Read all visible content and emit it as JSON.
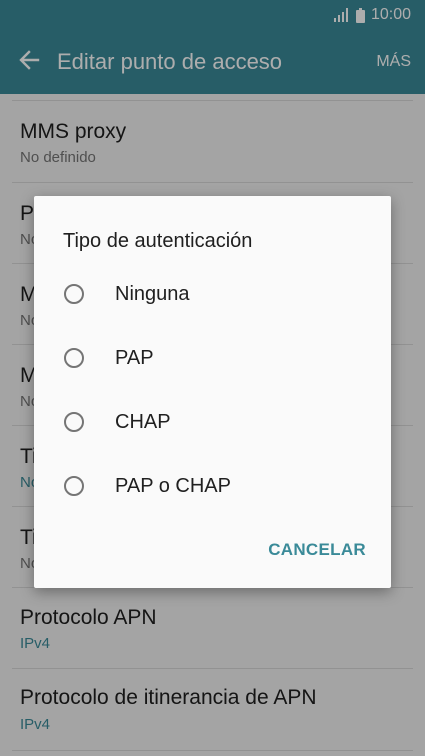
{
  "status_bar": {
    "time": "10:00",
    "icons": [
      "signal-icon",
      "battery-icon"
    ]
  },
  "app_bar": {
    "back_icon": "back-arrow-icon",
    "title": "Editar punto de acceso",
    "more_label": "MÁS"
  },
  "settings_list": {
    "items": [
      {
        "title": "MMS proxy",
        "subtitle": "No definido"
      },
      {
        "title": "P",
        "subtitle": "No"
      },
      {
        "title": "M",
        "subtitle": "No"
      },
      {
        "title": "M",
        "subtitle": "No"
      },
      {
        "title": "Ti",
        "subtitle": "No"
      },
      {
        "title": "Ti",
        "subtitle": "No"
      },
      {
        "title": "Protocolo APN",
        "subtitle": "IPv4"
      },
      {
        "title": "Protocolo de itinerancia de APN",
        "subtitle": "IPv4"
      }
    ]
  },
  "dialog": {
    "title": "Tipo de autenticación",
    "options": [
      {
        "label": "Ninguna",
        "selected": false
      },
      {
        "label": "PAP",
        "selected": false
      },
      {
        "label": "CHAP",
        "selected": false
      },
      {
        "label": "PAP o CHAP",
        "selected": false
      }
    ],
    "cancel_label": "CANCELAR"
  },
  "colors": {
    "primary": "#3a8a98",
    "text_primary": "#202020",
    "text_secondary": "#757575"
  }
}
